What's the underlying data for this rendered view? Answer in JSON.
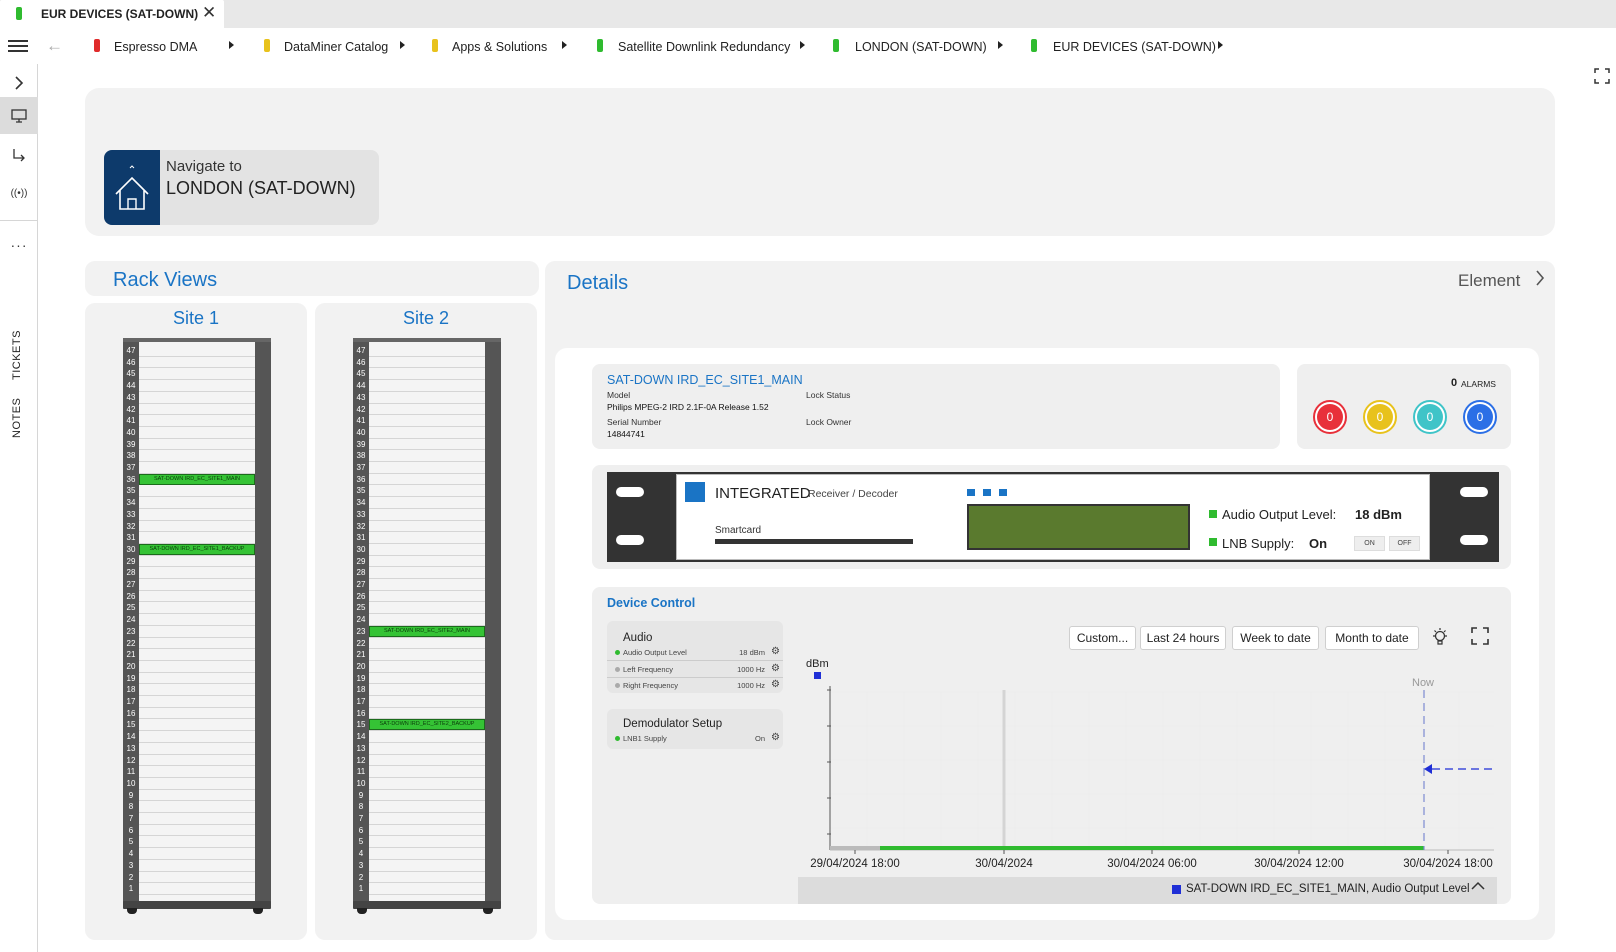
{
  "tab": {
    "title": "EUR DEVICES (SAT-DOWN)",
    "close": "✕",
    "status_color": "#2fbb2f"
  },
  "breadcrumbs": [
    {
      "label": "Espresso DMA",
      "status": "red"
    },
    {
      "label": "DataMiner Catalog",
      "status": "yellow"
    },
    {
      "label": "Apps & Solutions",
      "status": "yellow"
    },
    {
      "label": "Satellite Downlink Redundancy",
      "status": "green"
    },
    {
      "label": "LONDON (SAT-DOWN)",
      "status": "green"
    },
    {
      "label": "EUR DEVICES (SAT-DOWN)",
      "status": "green"
    }
  ],
  "rail": {
    "tickets": "TICKETS",
    "notes": "NOTES",
    "more": "···"
  },
  "navigate": {
    "label": "Navigate to",
    "target": "LONDON (SAT-DOWN)"
  },
  "rack_views": {
    "title": "Rack Views",
    "sites": [
      {
        "name": "Site 1",
        "devices": [
          {
            "label": "SAT-DOWN IRD_EC_SITE1_MAIN",
            "unit": 36
          },
          {
            "label": "SAT-DOWN IRD_EC_SITE1_BACKUP",
            "unit": 30
          }
        ]
      },
      {
        "name": "Site 2",
        "devices": [
          {
            "label": "SAT-DOWN IRD_EC_SITE2_MAIN",
            "unit": 23
          },
          {
            "label": "SAT-DOWN IRD_EC_SITE2_BACKUP",
            "unit": 15
          }
        ]
      }
    ],
    "units": 47
  },
  "details": {
    "title": "Details",
    "element_link": "Element",
    "element": {
      "name": "SAT-DOWN IRD_EC_SITE1_MAIN",
      "model_label": "Model",
      "model": "Philips MPEG-2 IRD 2.1F-0A Release 1.52",
      "serial_label": "Serial Number",
      "serial": "14844741",
      "lock_status_label": "Lock Status",
      "lock_owner_label": "Lock Owner"
    },
    "alarms": {
      "count": "0",
      "label": "ALARMS",
      "circles": [
        {
          "value": "0",
          "color": "#e8303a"
        },
        {
          "value": "0",
          "color": "#e8c21c"
        },
        {
          "value": "0",
          "color": "#3fc4c8"
        },
        {
          "value": "0",
          "color": "#2b6fe6"
        }
      ]
    },
    "device_front": {
      "brand": "INTEGRATED",
      "subtitle": "Receiver / Decoder",
      "smartcard": "Smartcard",
      "audio_label": "Audio Output Level:",
      "audio_value": "18 dBm",
      "lnb_label": "LNB Supply:",
      "lnb_value": "On",
      "on": "ON",
      "off": "OFF"
    },
    "device_control": {
      "title": "Device Control",
      "groups": [
        {
          "name": "Audio",
          "params": [
            {
              "name": "Audio Output Level",
              "value": "18 dBm",
              "active": true
            },
            {
              "name": "Left Frequency",
              "value": "1000 Hz",
              "active": false
            },
            {
              "name": "Right Frequency",
              "value": "1000 Hz",
              "active": false
            }
          ]
        },
        {
          "name": "Demodulator Setup",
          "params": [
            {
              "name": "LNB1 Supply",
              "value": "On",
              "active": true
            }
          ]
        }
      ],
      "buttons": [
        "Custom...",
        "Last 24 hours",
        "Week to date",
        "Month to date"
      ]
    }
  },
  "chart_data": {
    "type": "line",
    "ylabel": "dBm",
    "now_label": "Now",
    "x_ticks": [
      "29/04/2024 18:00",
      "30/04/2024",
      "30/04/2024 06:00",
      "30/04/2024 12:00",
      "30/04/2024 18:00"
    ],
    "series": [
      {
        "name": "SAT-DOWN IRD_EC_SITE1_MAIN, Audio Output Level",
        "color": "#1f2fd6"
      }
    ],
    "legend": "SAT-DOWN IRD_EC_SITE1_MAIN, Audio Output Level",
    "legend_placement": "bottom"
  }
}
